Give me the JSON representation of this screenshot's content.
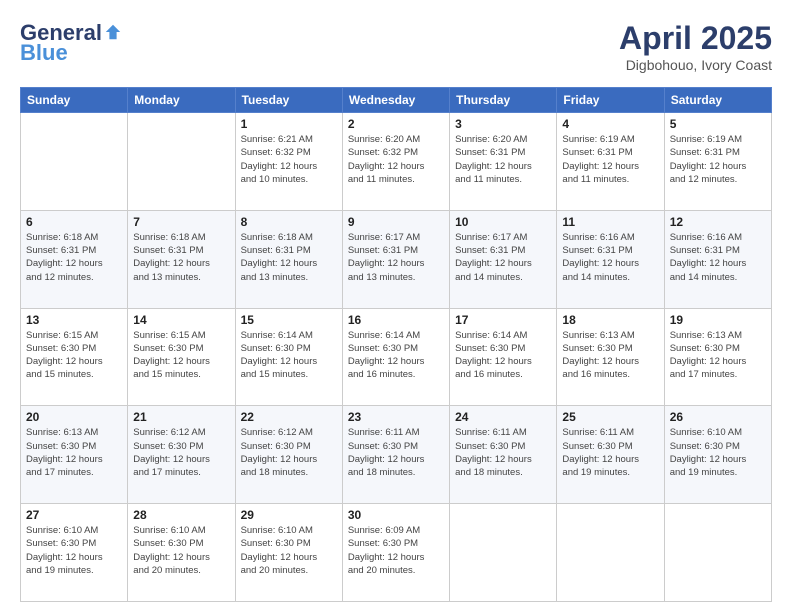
{
  "header": {
    "logo_general": "General",
    "logo_blue": "Blue",
    "title": "April 2025",
    "location": "Digbohouo, Ivory Coast"
  },
  "calendar": {
    "days_of_week": [
      "Sunday",
      "Monday",
      "Tuesday",
      "Wednesday",
      "Thursday",
      "Friday",
      "Saturday"
    ],
    "weeks": [
      [
        {
          "day": "",
          "info": ""
        },
        {
          "day": "",
          "info": ""
        },
        {
          "day": "1",
          "info": "Sunrise: 6:21 AM\nSunset: 6:32 PM\nDaylight: 12 hours\nand 10 minutes."
        },
        {
          "day": "2",
          "info": "Sunrise: 6:20 AM\nSunset: 6:32 PM\nDaylight: 12 hours\nand 11 minutes."
        },
        {
          "day": "3",
          "info": "Sunrise: 6:20 AM\nSunset: 6:31 PM\nDaylight: 12 hours\nand 11 minutes."
        },
        {
          "day": "4",
          "info": "Sunrise: 6:19 AM\nSunset: 6:31 PM\nDaylight: 12 hours\nand 11 minutes."
        },
        {
          "day": "5",
          "info": "Sunrise: 6:19 AM\nSunset: 6:31 PM\nDaylight: 12 hours\nand 12 minutes."
        }
      ],
      [
        {
          "day": "6",
          "info": "Sunrise: 6:18 AM\nSunset: 6:31 PM\nDaylight: 12 hours\nand 12 minutes."
        },
        {
          "day": "7",
          "info": "Sunrise: 6:18 AM\nSunset: 6:31 PM\nDaylight: 12 hours\nand 13 minutes."
        },
        {
          "day": "8",
          "info": "Sunrise: 6:18 AM\nSunset: 6:31 PM\nDaylight: 12 hours\nand 13 minutes."
        },
        {
          "day": "9",
          "info": "Sunrise: 6:17 AM\nSunset: 6:31 PM\nDaylight: 12 hours\nand 13 minutes."
        },
        {
          "day": "10",
          "info": "Sunrise: 6:17 AM\nSunset: 6:31 PM\nDaylight: 12 hours\nand 14 minutes."
        },
        {
          "day": "11",
          "info": "Sunrise: 6:16 AM\nSunset: 6:31 PM\nDaylight: 12 hours\nand 14 minutes."
        },
        {
          "day": "12",
          "info": "Sunrise: 6:16 AM\nSunset: 6:31 PM\nDaylight: 12 hours\nand 14 minutes."
        }
      ],
      [
        {
          "day": "13",
          "info": "Sunrise: 6:15 AM\nSunset: 6:30 PM\nDaylight: 12 hours\nand 15 minutes."
        },
        {
          "day": "14",
          "info": "Sunrise: 6:15 AM\nSunset: 6:30 PM\nDaylight: 12 hours\nand 15 minutes."
        },
        {
          "day": "15",
          "info": "Sunrise: 6:14 AM\nSunset: 6:30 PM\nDaylight: 12 hours\nand 15 minutes."
        },
        {
          "day": "16",
          "info": "Sunrise: 6:14 AM\nSunset: 6:30 PM\nDaylight: 12 hours\nand 16 minutes."
        },
        {
          "day": "17",
          "info": "Sunrise: 6:14 AM\nSunset: 6:30 PM\nDaylight: 12 hours\nand 16 minutes."
        },
        {
          "day": "18",
          "info": "Sunrise: 6:13 AM\nSunset: 6:30 PM\nDaylight: 12 hours\nand 16 minutes."
        },
        {
          "day": "19",
          "info": "Sunrise: 6:13 AM\nSunset: 6:30 PM\nDaylight: 12 hours\nand 17 minutes."
        }
      ],
      [
        {
          "day": "20",
          "info": "Sunrise: 6:13 AM\nSunset: 6:30 PM\nDaylight: 12 hours\nand 17 minutes."
        },
        {
          "day": "21",
          "info": "Sunrise: 6:12 AM\nSunset: 6:30 PM\nDaylight: 12 hours\nand 17 minutes."
        },
        {
          "day": "22",
          "info": "Sunrise: 6:12 AM\nSunset: 6:30 PM\nDaylight: 12 hours\nand 18 minutes."
        },
        {
          "day": "23",
          "info": "Sunrise: 6:11 AM\nSunset: 6:30 PM\nDaylight: 12 hours\nand 18 minutes."
        },
        {
          "day": "24",
          "info": "Sunrise: 6:11 AM\nSunset: 6:30 PM\nDaylight: 12 hours\nand 18 minutes."
        },
        {
          "day": "25",
          "info": "Sunrise: 6:11 AM\nSunset: 6:30 PM\nDaylight: 12 hours\nand 19 minutes."
        },
        {
          "day": "26",
          "info": "Sunrise: 6:10 AM\nSunset: 6:30 PM\nDaylight: 12 hours\nand 19 minutes."
        }
      ],
      [
        {
          "day": "27",
          "info": "Sunrise: 6:10 AM\nSunset: 6:30 PM\nDaylight: 12 hours\nand 19 minutes."
        },
        {
          "day": "28",
          "info": "Sunrise: 6:10 AM\nSunset: 6:30 PM\nDaylight: 12 hours\nand 20 minutes."
        },
        {
          "day": "29",
          "info": "Sunrise: 6:10 AM\nSunset: 6:30 PM\nDaylight: 12 hours\nand 20 minutes."
        },
        {
          "day": "30",
          "info": "Sunrise: 6:09 AM\nSunset: 6:30 PM\nDaylight: 12 hours\nand 20 minutes."
        },
        {
          "day": "",
          "info": ""
        },
        {
          "day": "",
          "info": ""
        },
        {
          "day": "",
          "info": ""
        }
      ]
    ]
  }
}
